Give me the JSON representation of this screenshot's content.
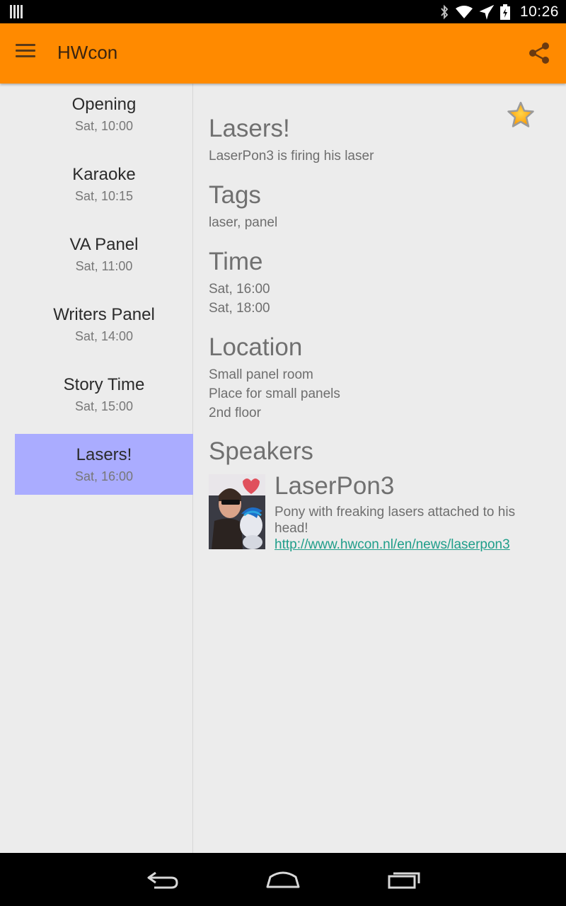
{
  "status_bar": {
    "time": "10:26",
    "icons": [
      "notification-icon",
      "bluetooth-icon",
      "wifi-icon",
      "airplane-icon",
      "battery-icon"
    ]
  },
  "app_bar": {
    "title": "HWcon",
    "color": "#ff8a00",
    "icons": [
      "menu-icon",
      "share-icon"
    ]
  },
  "events": [
    {
      "title": "Opening",
      "time": "Sat, 10:00",
      "selected": false
    },
    {
      "title": "Karaoke",
      "time": "Sat, 10:15",
      "selected": false
    },
    {
      "title": "VA Panel",
      "time": "Sat, 11:00",
      "selected": false
    },
    {
      "title": "Writers Panel",
      "time": "Sat, 14:00",
      "selected": false
    },
    {
      "title": "Story Time",
      "time": "Sat, 15:00",
      "selected": false
    },
    {
      "title": "Lasers!",
      "time": "Sat, 16:00",
      "selected": true
    }
  ],
  "selected_color": "#aaacff",
  "detail": {
    "title": "Lasers!",
    "description": "LaserPon3 is firing his laser",
    "tags_heading": "Tags",
    "tags": "laser, panel",
    "time_heading": "Time",
    "time_start": "Sat, 16:00",
    "time_end": "Sat, 18:00",
    "location_heading": "Location",
    "location_lines": [
      "Small panel room",
      "Place for small panels",
      "2nd floor"
    ],
    "speakers_heading": "Speakers",
    "favorite_icon": "star-icon",
    "speaker": {
      "name": "LaserPon3",
      "description": "Pony with freaking lasers attached to his head!",
      "link": "http://www.hwcon.nl/en/news/laserpon3",
      "link_color": "#1f9e8a"
    }
  },
  "nav_bar": {
    "icons": [
      "back-icon",
      "home-icon",
      "recents-icon"
    ]
  }
}
